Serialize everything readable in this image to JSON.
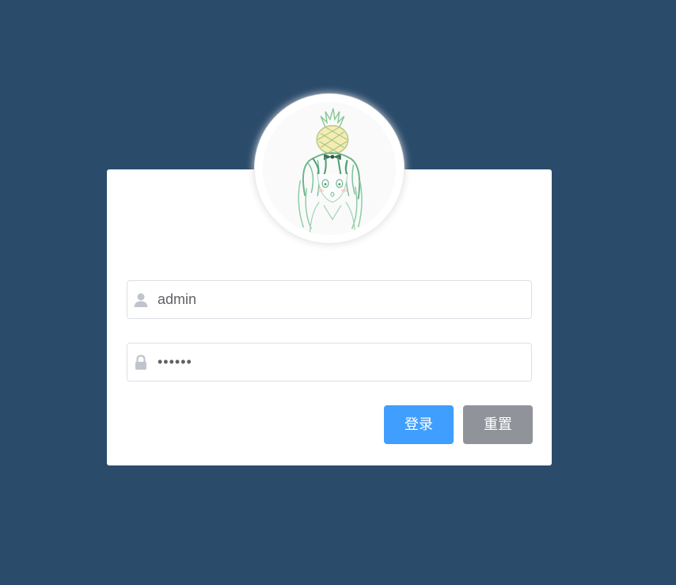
{
  "login_form": {
    "avatar_icon": "anime-girl-pineapple-avatar",
    "username": {
      "icon": "user-icon",
      "value": "admin"
    },
    "password": {
      "icon": "lock-icon",
      "value": "123456"
    },
    "buttons": {
      "login_label": "登录",
      "reset_label": "重置"
    }
  },
  "colors": {
    "background": "#2b4b6b",
    "primary": "#409eff",
    "info": "#909399"
  }
}
